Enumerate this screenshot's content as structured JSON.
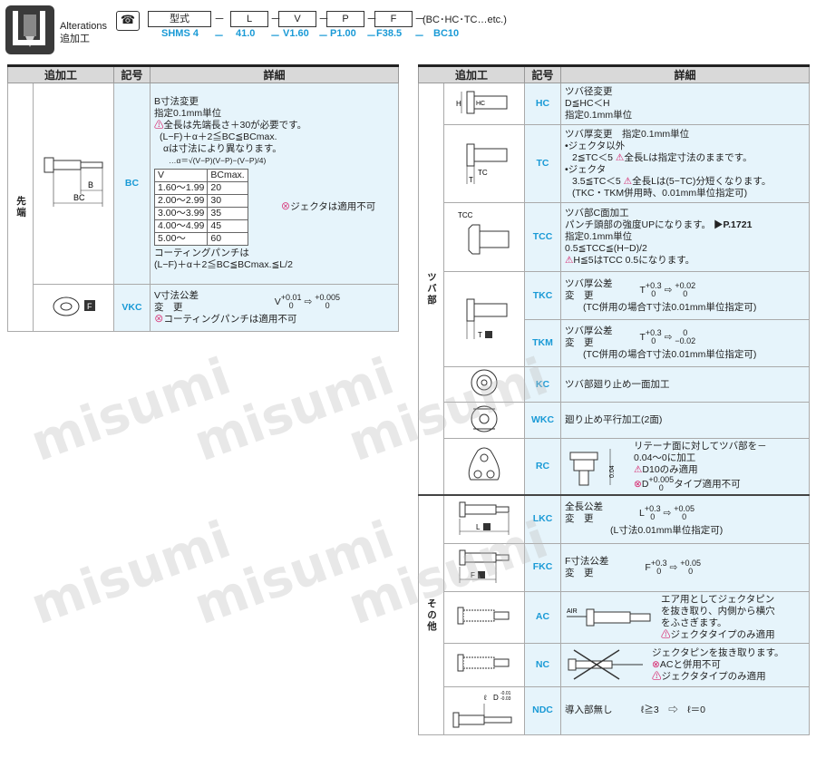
{
  "header": {
    "title_line1": "Alterations",
    "title_line2": "追加工",
    "code_boxes": [
      "型式",
      "L",
      "V",
      "P",
      "F"
    ],
    "code_tail": "(BC･HC･TC…etc.)",
    "example": [
      "SHMS 4",
      "41.0",
      "V1.60",
      "P1.00",
      "F38.5",
      "BC10"
    ],
    "dash": "－"
  },
  "left_table": {
    "headers": [
      "追加工",
      "記号",
      "詳細"
    ],
    "groups": [
      {
        "label": "先端",
        "rows": [
          {
            "symbol": "BC",
            "fig_labels": [
              "B",
              "BC"
            ],
            "details": [
              "B寸法変更",
              "指定0.1mm単位",
              "全長は先端長さ＋30が必要です。",
              "(L−F)＋α＋2≦BC≦BCmax.",
              "αは寸法により異なります。",
              "…α＝√(V−P)(V−P)−(V−P)/4)",
              "コーティングパンチは",
              "(L−F)＋α＋2≦BC≦BCmax.≦L/2"
            ],
            "mini_table": {
              "headers": [
                "V",
                "BCmax."
              ],
              "rows": [
                [
                  "1.60～1.99",
                  "20"
                ],
                [
                  "2.00～2.99",
                  "30"
                ],
                [
                  "3.00～3.99",
                  "35"
                ],
                [
                  "4.00～4.99",
                  "45"
                ],
                [
                  "5.00～",
                  "60"
                ]
              ]
            },
            "note": "ジェクタは適用不可"
          },
          {
            "symbol": "VKC",
            "details": [
              "V寸法公差",
              "変　更"
            ],
            "tol_a": "V",
            "tol_a_up": "+0.01",
            "tol_a_low": "0",
            "tol_b_up": "+0.005",
            "tol_b_low": "0",
            "note": "コーティングパンチは適用不可"
          }
        ]
      }
    ]
  },
  "right_table": {
    "headers": [
      "追加工",
      "記号",
      "詳細"
    ],
    "groups": [
      {
        "label": "ツバ部",
        "rows": [
          {
            "symbol": "HC",
            "fig_labels": [
              "H",
              "HC"
            ],
            "details": [
              "ツバ径変更",
              "D≦HC＜H",
              "指定0.1mm単位"
            ]
          },
          {
            "symbol": "TC",
            "fig_labels": [
              "TC",
              "T"
            ],
            "details": [
              "ツバ厚変更　指定0.1mm単位",
              "•ジェクタ以外",
              "2≦TC＜5",
              "全長Lは指定寸法のままです。",
              "•ジェクタ",
              "3.5≦TC＜5",
              "全長Lは(5−TC)分短くなります。",
              "(TKC・TKM併用時、0.01mm単位指定可)"
            ]
          },
          {
            "symbol": "TCC",
            "fig_labels": [
              "TCC"
            ],
            "details": [
              "ツバ部C面加工",
              "パンチ頭部の強度UPになります。",
              "P.1721",
              "指定0.1mm単位",
              "0.5≦TCC≦(H−D)/2",
              "H≦5はTCC 0.5になります。"
            ]
          },
          {
            "symbol": "TKC",
            "fig_labels": [
              "T"
            ],
            "details": [
              "ツバ厚公差",
              "変　更",
              "(TC併用の場合T寸法0.01mm単位指定可)"
            ],
            "tol_a": "T",
            "tol_a_up": "+0.3",
            "tol_a_low": "0",
            "tol_b_up": "+0.02",
            "tol_b_low": "0"
          },
          {
            "symbol": "TKM",
            "details": [
              "ツバ厚公差",
              "変　更",
              "(TC併用の場合T寸法0.01mm単位指定可)"
            ],
            "tol_a": "T",
            "tol_a_up": "+0.3",
            "tol_a_low": "0",
            "tol_b_up": "0",
            "tol_b_low": "−0.02"
          },
          {
            "symbol": "KC",
            "details": [
              "ツバ部廻り止め一面加工"
            ]
          },
          {
            "symbol": "WKC",
            "details": [
              "廻り止め平行加工(2面)"
            ]
          },
          {
            "symbol": "RC",
            "fig_labels": [
              "0.04"
            ],
            "details": [
              "リテーナ面に対してツバ部を－",
              "0.04～0に加工",
              "D10のみ適用",
              "タイプ適用不可"
            ],
            "tol_b_up": "+0.005",
            "tol_b_low": "0",
            "tol_a": "D"
          }
        ]
      },
      {
        "label": "その他",
        "rows": [
          {
            "symbol": "LKC",
            "fig_labels": [
              "L"
            ],
            "details": [
              "全長公差",
              "変　更",
              "(L寸法0.01mm単位指定可)"
            ],
            "tol_a": "L",
            "tol_a_up": "+0.3",
            "tol_a_low": "0",
            "tol_b_up": "+0.05",
            "tol_b_low": "0"
          },
          {
            "symbol": "FKC",
            "fig_labels": [
              "F"
            ],
            "details": [
              "F寸法公差",
              "変　更"
            ],
            "tol_a": "F",
            "tol_a_up": "+0.3",
            "tol_a_low": "0",
            "tol_b_up": "+0.05",
            "tol_b_low": "0"
          },
          {
            "symbol": "AC",
            "fig_labels": [
              "AIR"
            ],
            "details": [
              "エア用としてジェクタピン",
              "を抜き取り、内側から横穴",
              "をふさぎます。",
              "ジェクタタイプのみ適用"
            ]
          },
          {
            "symbol": "NC",
            "details": [
              "ジェクタピンを抜き取ります。",
              "ACと併用不可",
              "ジェクタタイプのみ適用"
            ]
          },
          {
            "symbol": "NDC",
            "fig_labels": [
              "ℓ",
              "D",
              "-0.01",
              "-0.03"
            ],
            "details": [
              "導入部無し",
              "ℓ≧3",
              "ℓ＝0"
            ]
          }
        ]
      }
    ]
  },
  "watermark": "misumi",
  "colors": {
    "accent": "#1a9ad6",
    "detail_bg": "#e6f4fb",
    "warn": "#d6246c",
    "header_bg": "#d9d9d9"
  }
}
